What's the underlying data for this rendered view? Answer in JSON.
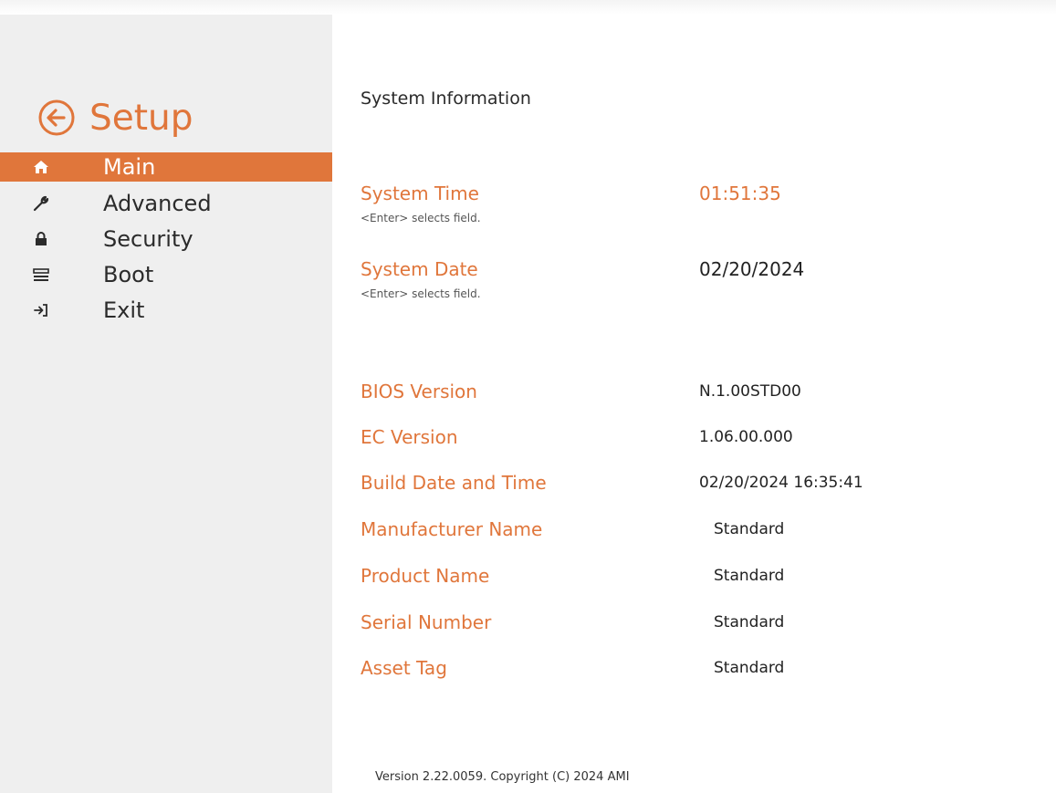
{
  "sidebar": {
    "title": "Setup",
    "items": [
      {
        "label": "Main",
        "icon": "home-icon",
        "active": true
      },
      {
        "label": "Advanced",
        "icon": "wrench-icon",
        "active": false
      },
      {
        "label": "Security",
        "icon": "lock-icon",
        "active": false
      },
      {
        "label": "Boot",
        "icon": "drive-icon",
        "active": false
      },
      {
        "label": "Exit",
        "icon": "exit-icon",
        "active": false
      }
    ]
  },
  "main": {
    "section_title": "System Information",
    "time": {
      "label": "System Time",
      "value": "01:51:35",
      "hint": "<Enter> selects field."
    },
    "date": {
      "label": "System Date",
      "value": "02/20/2024",
      "hint": "<Enter> selects field."
    },
    "info": [
      {
        "label": "BIOS Version",
        "value": "N.1.00STD00"
      },
      {
        "label": "EC Version",
        "value": "1.06.00.000"
      },
      {
        "label": "Build Date and Time",
        "value": "02/20/2024 16:35:41"
      },
      {
        "label": "Manufacturer Name",
        "value": "Standard"
      },
      {
        "label": "Product Name",
        "value": "Standard"
      },
      {
        "label": "Serial Number",
        "value": "Standard"
      },
      {
        "label": "Asset Tag",
        "value": "Standard"
      }
    ]
  },
  "footer": "Version 2.22.0059. Copyright (C) 2024 AMI",
  "colors": {
    "accent": "#e0763b",
    "sidebar_bg": "#efefef",
    "text": "#222222"
  }
}
